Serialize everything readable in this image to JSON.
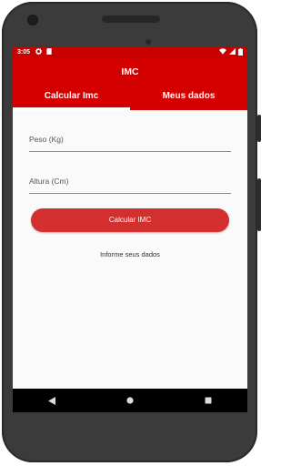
{
  "status_bar": {
    "time": "3:05",
    "icons": [
      "gear-icon",
      "sd-card-icon",
      "wifi-icon",
      "signal-icon",
      "battery-icon"
    ]
  },
  "app_bar": {
    "title": "IMC"
  },
  "tabs": [
    {
      "label": "Calcular Imc",
      "active": true
    },
    {
      "label": "Meus dados",
      "active": false
    }
  ],
  "form": {
    "weight_placeholder": "Peso (Kg)",
    "weight_value": "",
    "height_placeholder": "Altura (Cm)",
    "height_value": "",
    "calculate_button": "Calcular IMC",
    "result_text": "Informe seus dados"
  },
  "nav_bar": {
    "icons": [
      "back-icon",
      "home-icon",
      "recents-icon"
    ]
  },
  "colors": {
    "status_bar": "#c90000",
    "app_bar": "#d40000",
    "button": "#d32f2f",
    "device_frame": "#3b3b3b"
  }
}
